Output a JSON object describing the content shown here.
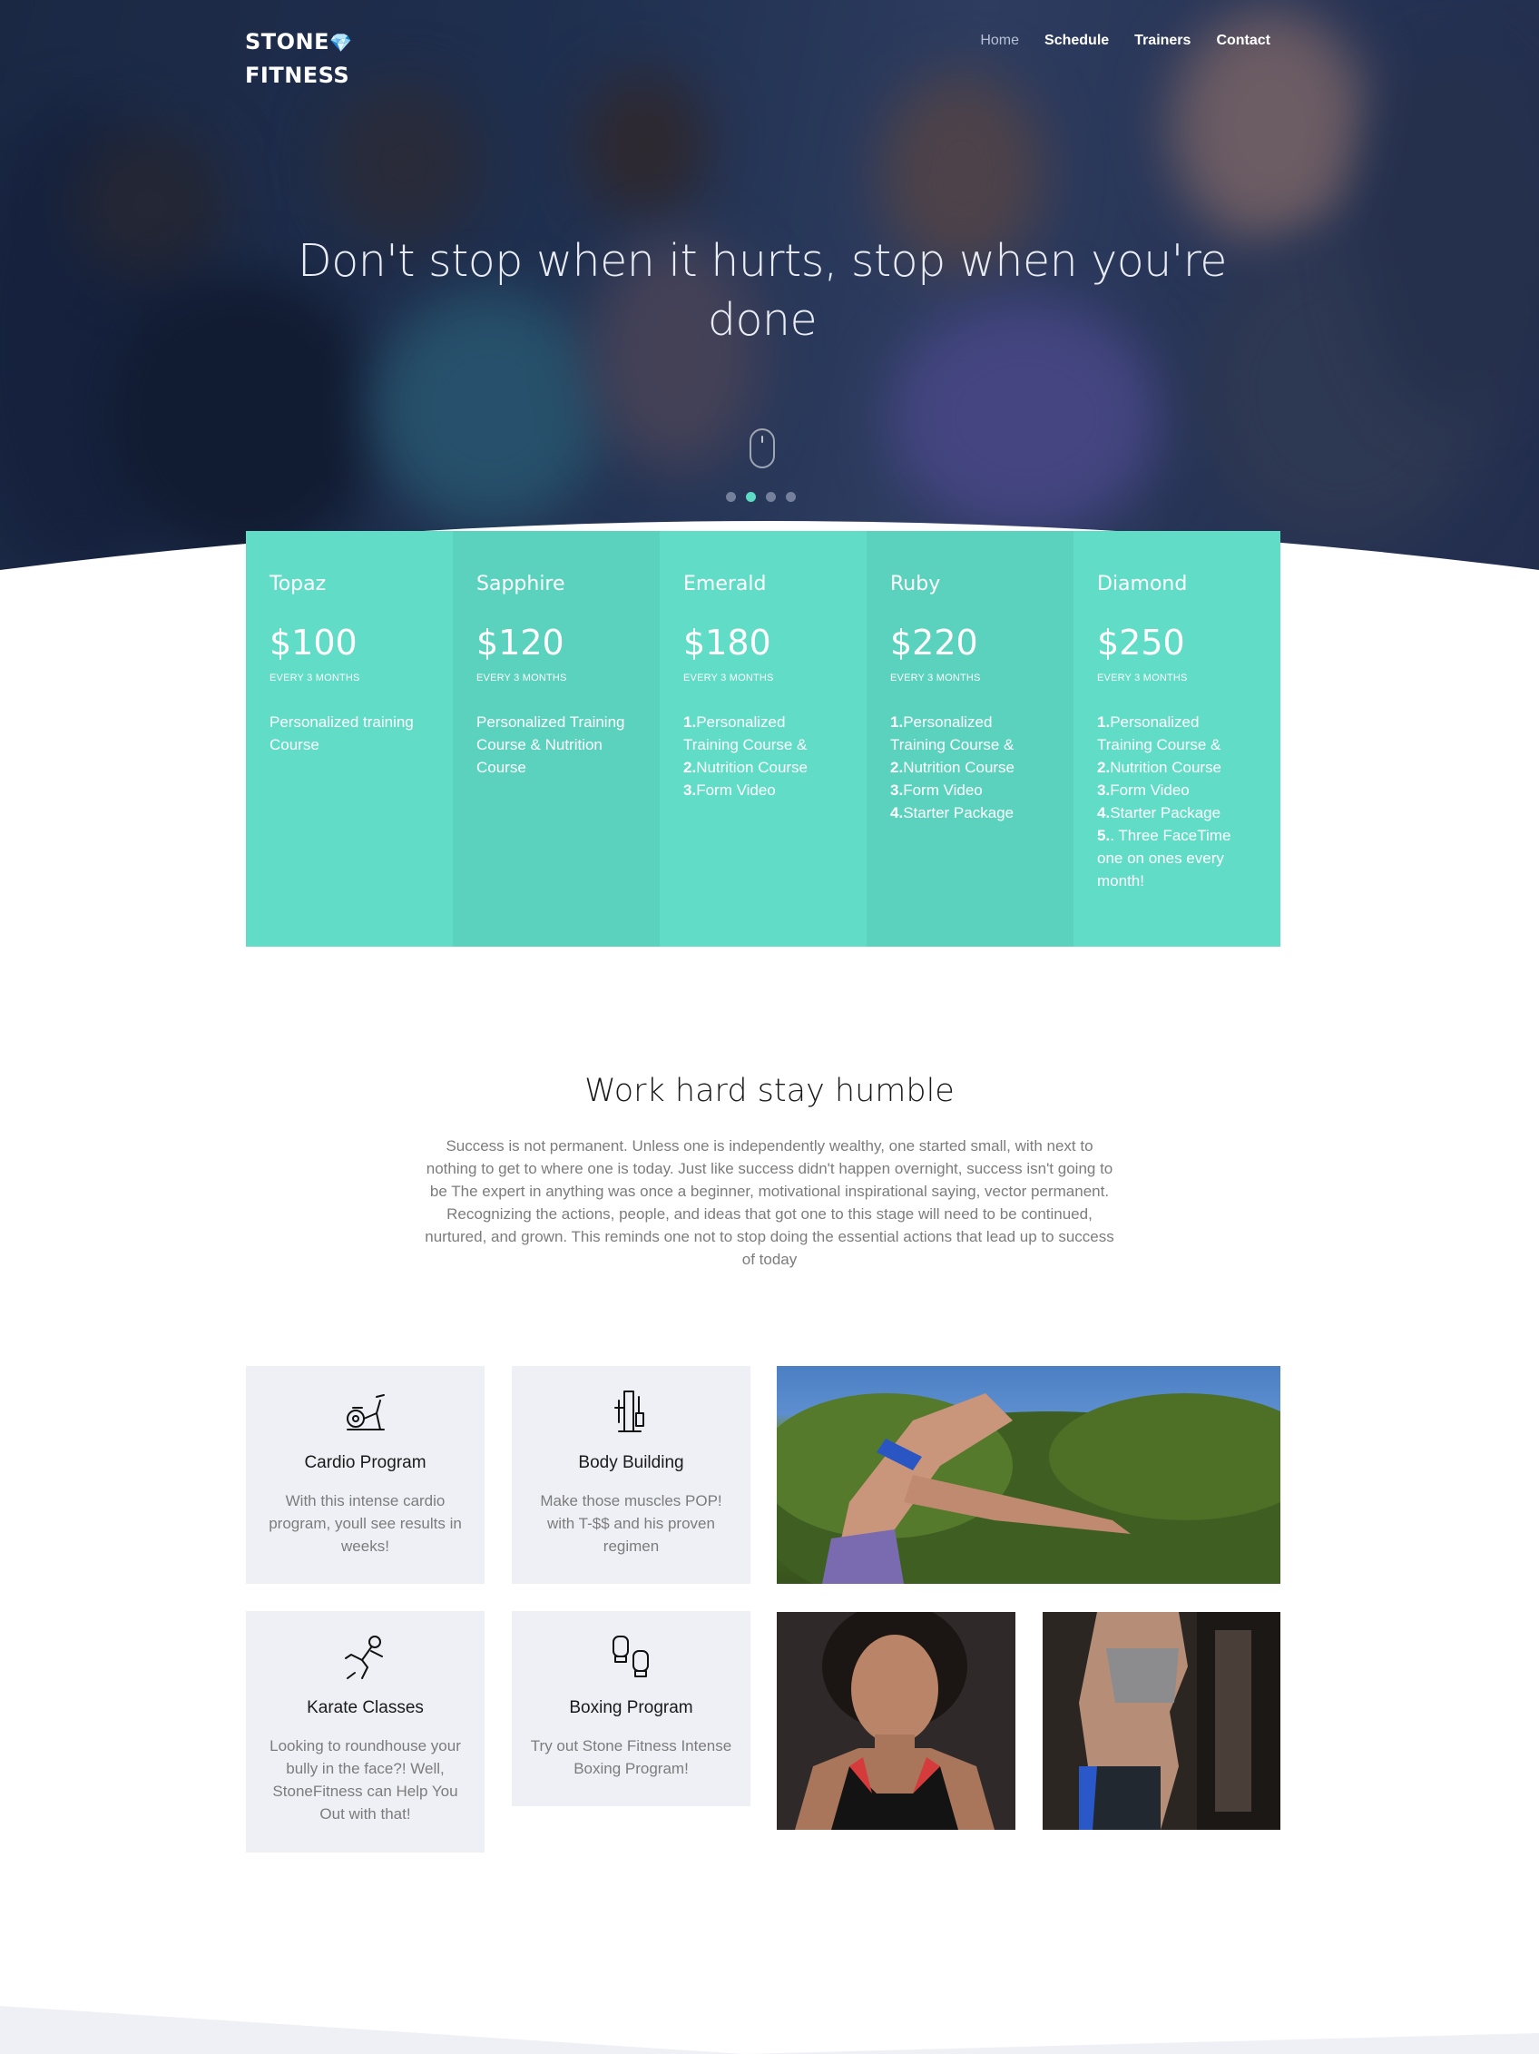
{
  "brand": {
    "line1": "STONE",
    "line2": "FITNESS",
    "gem": "💎"
  },
  "nav": {
    "items": [
      "Home",
      "Schedule",
      "Trainers",
      "Contact"
    ],
    "active": "Home"
  },
  "hero": {
    "title": "Don't stop when it hurts, stop when you're done",
    "slides": 4,
    "active_slide": 2
  },
  "pricing": [
    {
      "name": "Topaz",
      "price": "$100",
      "period": "EVERY 3 MONTHS",
      "features": [
        {
          "n": "",
          "t": "Personalized training Course"
        }
      ]
    },
    {
      "name": "Sapphire",
      "price": "$120",
      "period": "EVERY 3 MONTHS",
      "features": [
        {
          "n": "",
          "t": "Personalized Training Course & Nutrition Course"
        }
      ]
    },
    {
      "name": "Emerald",
      "price": "$180",
      "period": "EVERY 3 MONTHS",
      "features": [
        {
          "n": "1.",
          "t": "Personalized Training Course &"
        },
        {
          "n": "2.",
          "t": "Nutrition Course"
        },
        {
          "n": "3.",
          "t": "Form Video"
        }
      ]
    },
    {
      "name": "Ruby",
      "price": "$220",
      "period": "EVERY 3 MONTHS",
      "features": [
        {
          "n": "1.",
          "t": "Personalized Training Course &"
        },
        {
          "n": "2.",
          "t": "Nutrition Course"
        },
        {
          "n": "3.",
          "t": "Form Video"
        },
        {
          "n": "4.",
          "t": "Starter Package"
        }
      ]
    },
    {
      "name": "Diamond",
      "price": "$250",
      "period": "EVERY 3 MONTHS",
      "features": [
        {
          "n": "1.",
          "t": "Personalized Training Course &"
        },
        {
          "n": "2.",
          "t": "Nutrition Course"
        },
        {
          "n": "3.",
          "t": "Form Video"
        },
        {
          "n": "4.",
          "t": "Starter Package"
        },
        {
          "n": "5.",
          "t": ". Three FaceTime one on ones every month!"
        }
      ]
    }
  ],
  "intro": {
    "title": "Work hard stay humble",
    "text": "Success is not permanent. Unless one is independently wealthy, one started small, with next to nothing to get to where one is today. Just like success didn't happen overnight, success isn't going to be The expert in anything was once a beginner, motivational inspirational saying, vector permanent. Recognizing the actions, people, and ideas that got one to this stage will need to be continued, nurtured, and grown. This reminds one not to stop doing the essential actions that lead up to success of today"
  },
  "services": [
    {
      "title": "Cardio Program",
      "desc": "With this intense cardio program, youll see results in weeks!",
      "icon": "exercise-bike-icon"
    },
    {
      "title": "Body Building",
      "desc": "Make those muscles POP! with T-$$ and his proven regimen",
      "icon": "weight-machine-icon"
    },
    {
      "title": "Karate Classes",
      "desc": "Looking to roundhouse your bully in the face?! Well, StoneFitness can Help You Out with that!",
      "icon": "karate-kick-icon"
    },
    {
      "title": "Boxing Program",
      "desc": "Try out Stone Fitness Intense Boxing Program!",
      "icon": "boxing-gloves-icon"
    }
  ],
  "colors": {
    "accent": "#61dcc6",
    "accent_alt": "#5bd2bd",
    "card_bg": "#eff0f5",
    "hero_bg": "#24385a"
  }
}
